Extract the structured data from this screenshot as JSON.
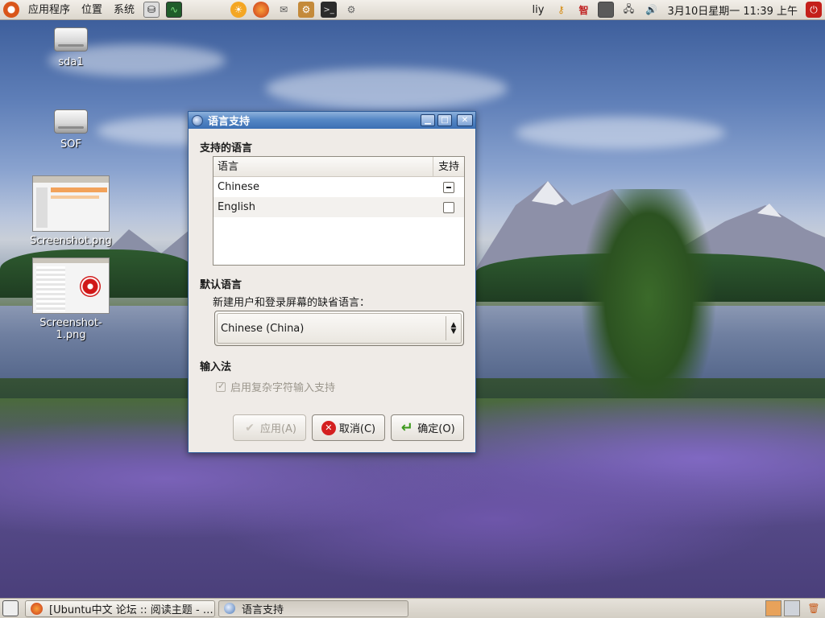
{
  "top_panel": {
    "menus": [
      "应用程序",
      "位置",
      "系统"
    ],
    "user": "liy",
    "clock": "3月10日星期一 11:39 上午",
    "launcher_icons": [
      "firefox-icon",
      "mail-icon",
      "package-icon",
      "terminal-icon",
      "settings-icon"
    ],
    "tray_icons": [
      "network-key-icon",
      "input-method-icon",
      "screen-icon",
      "network-icon",
      "volume-icon",
      "power-icon"
    ]
  },
  "desktop": {
    "icons": [
      {
        "label": "sda1",
        "icon": "drive-icon"
      },
      {
        "label": "SOF",
        "icon": "drive-icon"
      },
      {
        "label": "Screenshot.png",
        "icon": "image-thumbnail"
      },
      {
        "label": "Screenshot-1.png",
        "icon": "image-thumbnail"
      }
    ]
  },
  "dialog": {
    "title": "语言支持",
    "supported_section": "支持的语言",
    "table": {
      "headers": [
        "语言",
        "支持"
      ],
      "rows": [
        {
          "language": "Chinese",
          "support": "mixed"
        },
        {
          "language": "English",
          "support": "unchecked"
        }
      ]
    },
    "default_section": "默认语言",
    "default_label": "新建用户和登录屏幕的缺省语言：",
    "default_value": "Chinese (China)",
    "input_section": "输入法",
    "input_checkbox": "启用复杂字符输入支持",
    "buttons": {
      "apply": "应用(A)",
      "cancel": "取消(C)",
      "ok": "确定(O)"
    }
  },
  "bottom_panel": {
    "tasks": [
      {
        "label": "[Ubuntu中文 论坛 :: 阅读主题 - …",
        "icon": "firefox-icon"
      },
      {
        "label": "语言支持",
        "icon": "language-icon"
      }
    ]
  },
  "colors": {
    "titlebar": "#3b6fb3",
    "panel": "#dcd7cd",
    "dialog_bg": "#efebe7"
  }
}
